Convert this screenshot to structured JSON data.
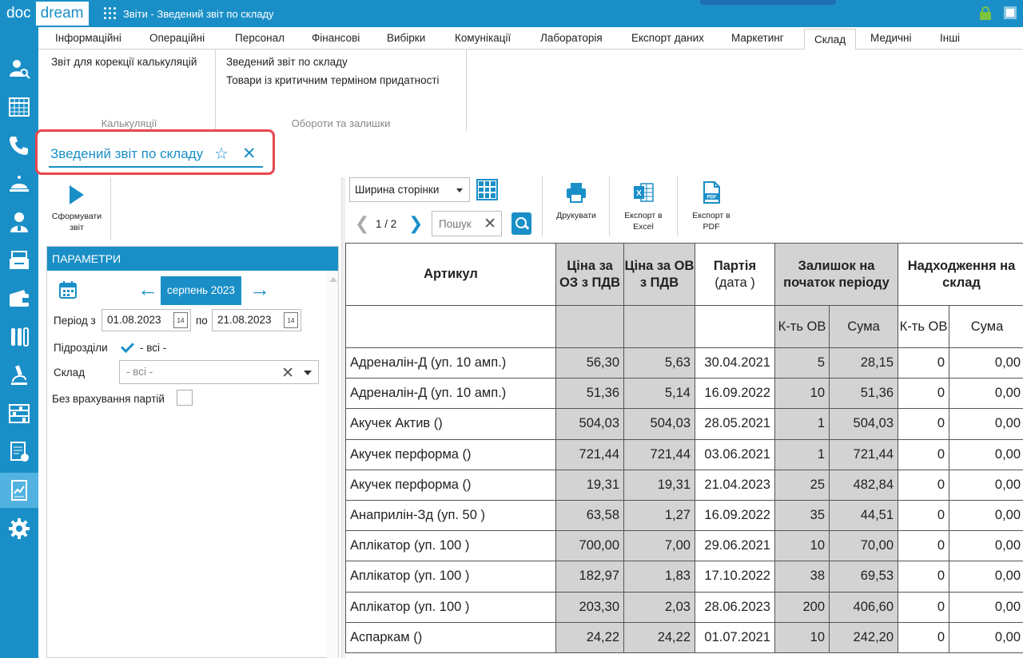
{
  "app": {
    "logo_doc": "doc",
    "logo_dream": "dream",
    "window_title": "Звіти - Зведений звіт по складу"
  },
  "menu": {
    "tabs": [
      "Інформаційні",
      "Операційні",
      "Персонал",
      "Фінансові",
      "Вибірки",
      "Комунікації",
      "Лабораторія",
      "Експорт даних",
      "Маркетинг",
      "Склад",
      "Медичні",
      "Інші"
    ],
    "active": "Склад"
  },
  "ribbon": {
    "group1": {
      "items": [
        "Звіт для корекції калькуляцій"
      ],
      "label": "Калькуляції"
    },
    "group2": {
      "items": [
        "Зведений звіт по складу",
        "Товари із критичним терміном придатності"
      ],
      "label": "Обороти та залишки"
    }
  },
  "doc_tab": {
    "title": "Зведений звіт по складу"
  },
  "left_toolbar": {
    "form_button": "Сформувати звіт"
  },
  "params": {
    "header": "ПАРАМЕТРИ",
    "month": "серпень 2023",
    "period_label": "Період з",
    "date_from": "01.08.2023",
    "to_label": "по",
    "date_to": "21.08.2023",
    "date_icon_text": "14",
    "subdivisions_label": "Підрозділи",
    "subdivisions_value": "- всі -",
    "subdivisions_checked": true,
    "warehouse_label": "Склад",
    "warehouse_value": "- всі -",
    "no_batches_label": "Без врахування партій",
    "no_batches_checked": false
  },
  "report_toolbar": {
    "zoom": "Ширина сторінки",
    "page": "1 / 2",
    "search_placeholder": "Пошук",
    "print": "Друкувати",
    "export_excel": "Експорт в Excel",
    "export_pdf": "Експорт в PDF"
  },
  "table": {
    "headers": {
      "article": "Артикул",
      "price_oz": "Ціна за ОЗ з ПДВ",
      "price_ov": "Ціна за ОВ з ПДВ",
      "batch": "Партія",
      "batch_sub": "(дата )",
      "balance_start": "Залишок на початок періоду",
      "income": "Надходження на склад",
      "qty_ov": "К-ть ОВ",
      "sum": "Сума"
    },
    "rows": [
      [
        "Адреналін-Д (уп. 10 амп.)",
        "56,30",
        "5,63",
        "30.04.2021",
        "5",
        "28,15",
        "0",
        "0,00"
      ],
      [
        "Адреналін-Д (уп. 10 амп.)",
        "51,36",
        "5,14",
        "16.09.2022",
        "10",
        "51,36",
        "0",
        "0,00"
      ],
      [
        "Акучек Актив ()",
        "504,03",
        "504,03",
        "28.05.2021",
        "1",
        "504,03",
        "0",
        "0,00"
      ],
      [
        "Акучек перформа ()",
        "721,44",
        "721,44",
        "03.06.2021",
        "1",
        "721,44",
        "0",
        "0,00"
      ],
      [
        "Акучек перформа ()",
        "19,31",
        "19,31",
        "21.04.2023",
        "25",
        "482,84",
        "0",
        "0,00"
      ],
      [
        "Анаприлін-Зд (уп. 50 )",
        "63,58",
        "1,27",
        "16.09.2022",
        "35",
        "44,51",
        "0",
        "0,00"
      ],
      [
        "Аплікатор (уп. 100 )",
        "700,00",
        "7,00",
        "29.06.2021",
        "10",
        "70,00",
        "0",
        "0,00"
      ],
      [
        "Аплікатор (уп. 100 )",
        "182,97",
        "1,83",
        "17.10.2022",
        "38",
        "69,53",
        "0",
        "0,00"
      ],
      [
        "Аплікатор (уп. 100 )",
        "203,30",
        "2,03",
        "28.06.2023",
        "200",
        "406,60",
        "0",
        "0,00"
      ],
      [
        "Аспаркам ()",
        "24,22",
        "24,22",
        "01.07.2021",
        "10",
        "242,20",
        "0",
        "0,00"
      ]
    ]
  },
  "colors": {
    "primary": "#1a8fc7",
    "highlight": "#e8474f",
    "lock": "#7ec23f",
    "gray_col": "#d3d3d3"
  }
}
